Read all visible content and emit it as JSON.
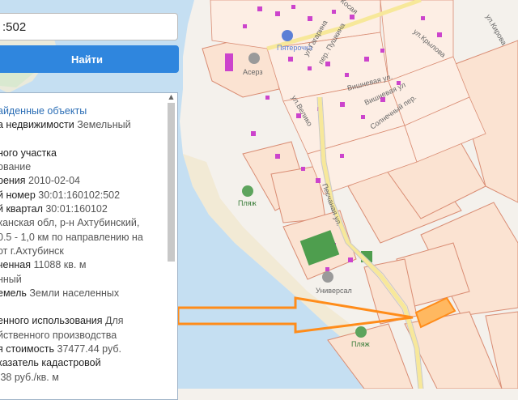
{
  "search": {
    "value": ":502"
  },
  "find_button": {
    "label": "Найти"
  },
  "info": {
    "title": "айденные объекты",
    "lines": [
      {
        "l": "а недвижимости ",
        "v": "Земельный"
      },
      {
        "l": "",
        "v": ""
      },
      {
        "l": "ного участка",
        "v": ""
      },
      {
        "l": "",
        "v": "ование"
      },
      {
        "l": "рения ",
        "v": "2010-02-04"
      },
      {
        "l": "й номер ",
        "v": "30:01:160102:502"
      },
      {
        "l": "й квартал ",
        "v": "30:01:160102"
      },
      {
        "l": "",
        "v": "ханская обл, р-н Ахтубинский,"
      },
      {
        "l": "",
        "v": " 0.5 - 1,0 км по направлению на"
      },
      {
        "l": "",
        "v": "от г.Ахтубинск"
      },
      {
        "l": "ченная ",
        "v": "11088 кв. м"
      },
      {
        "l": "",
        "v": "нный"
      },
      {
        "l": "емель ",
        "v": "Земли населенных"
      },
      {
        "l": "",
        "v": ""
      },
      {
        "l": "енного использования ",
        "v": "Для"
      },
      {
        "l": "",
        "v": "йственного производства"
      },
      {
        "l": "я стоимость ",
        "v": "37477.44 руб."
      },
      {
        "l": "казатель кадастровой",
        "v": ""
      },
      {
        "l": "",
        "v": ".38 руб./кв. м"
      }
    ]
  },
  "map": {
    "streets": [
      "ул.Кирова",
      "ул.Крылова",
      "ул.Гагарина",
      "пер. Пушкина",
      "Вишневая ул.",
      "Солнечный пер.",
      "ул.Велико",
      "Песчаная ул.",
      "Косая",
      "Вишневая ул"
    ],
    "pois": [
      "Пятерочка",
      "Асерз",
      "Пляж",
      "Универсал",
      "Пляж"
    ],
    "colors": {
      "water": "#c5dff2",
      "land": "#f4f1ec",
      "parcel_fill": "#fbe3d2",
      "parcel_stroke": "#d98c73",
      "building": "#cc44cc",
      "green": "#4e9e4e",
      "road": "#f7e89a",
      "highlight": "#ff8c1a"
    }
  }
}
